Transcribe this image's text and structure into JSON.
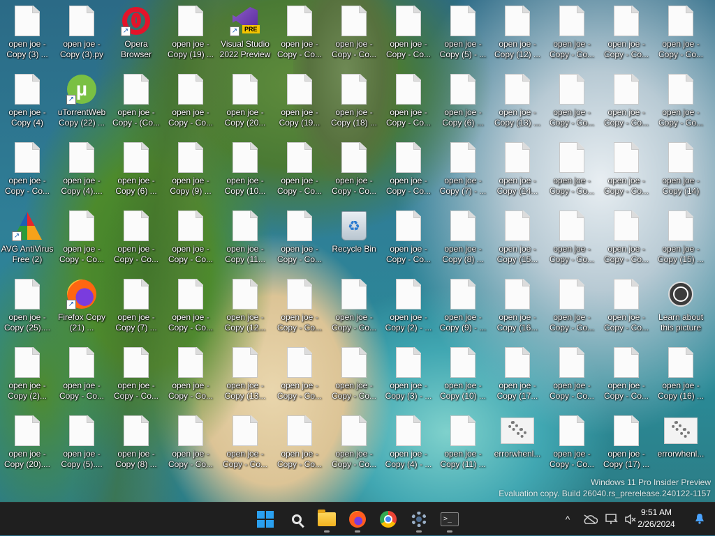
{
  "desktop": {
    "icons": [
      [
        "open joe - Copy (3) ...",
        "open joe - Copy (3).py",
        "Opera Browser",
        "open joe - Copy (19) ...",
        "Visual Studio 2022 Preview",
        "open joe - Copy - Co...",
        "open joe - Copy - Co...",
        "open joe - Copy - Co...",
        "open joe - Copy (5) - ...",
        "open joe - Copy (12) ...",
        "open joe - Copy - Co...",
        "open joe - Copy - Co...",
        "open joe - Copy - Co..."
      ],
      [
        "open joe - Copy (4)",
        "uTorrentWeb Copy (22) ...",
        "open joe - Copy - (Co...",
        "open joe - Copy - Co...",
        "open joe - Copy (20...",
        "open joe - Copy (19...",
        "open joe - Copy (18) ...",
        "open joe - Copy - Co...",
        "open joe - Copy (6) ...",
        "open joe - Copy (13) ...",
        "open joe - Copy - Co...",
        "open joe - Copy - Co...",
        "open joe - Copy - Co..."
      ],
      [
        "open joe - Copy - Co...",
        "open joe - Copy (4)....",
        "open joe - Copy (6) ...",
        "open joe - Copy (9) ...",
        "open joe - Copy (10...",
        "open joe - Copy - Co...",
        "open joe - Copy - Co...",
        "open joe - Copy - Co...",
        "open joe - Copy (7) - ...",
        "open joe - Copy (14...",
        "open joe - Copy - Co...",
        "open joe - Copy - Co...",
        "open joe - Copy (14)"
      ],
      [
        "AVG AntiVirus Free (2)",
        "open joe - Copy - Co...",
        "open joe - Copy - Co...",
        "open joe - Copy - Co...",
        "open joe - Copy (11...",
        "open joe - Copy - Co...",
        "Recycle Bin",
        "open joe - Copy - Co...",
        "open joe - Copy (8) ...",
        "open joe - Copy (15...",
        "open joe - Copy - Co...",
        "open joe - Copy - Co...",
        "open joe - Copy (15) ..."
      ],
      [
        "open joe - Copy (25)....",
        "Firefox Copy (21) ...",
        "open joe - Copy (7) ...",
        "open joe - Copy - Co...",
        "open joe - Copy (12...",
        "open joe - Copy - Co...",
        "open joe - Copy - Co...",
        "open joe - Copy (2) - ...",
        "open joe - Copy (9) - ...",
        "open joe - Copy (16...",
        "open joe - Copy - Co...",
        "open joe - Copy - Co...",
        "Learn about this picture"
      ],
      [
        "open joe - Copy (2)...",
        "open joe - Copy - Co...",
        "open joe - Copy - Co...",
        "open joe - Copy - Co...",
        "open joe - Copy (13...",
        "open joe - Copy - Co...",
        "open joe - Copy - Co...",
        "open joe - Copy (3) - ...",
        "open joe - Copy (10) ...",
        "open joe - Copy (17...",
        "open joe - Copy - Co...",
        "open joe - Copy - Co...",
        "open joe - Copy (16) ..."
      ],
      [
        "open joe - Copy (20)....",
        "open joe - Copy (5)....",
        "open joe - Copy (8) ...",
        "open joe - Copy - Co...",
        "open joe - Copy - Co...",
        "open joe - Copy - Co...",
        "open joe - Copy - Co...",
        "open joe - Copy (4) - ...",
        "open joe - Copy (11) ...",
        "errorwhenl...",
        "open joe - Copy - Co...",
        "open joe - Copy (17) ...",
        "errorwhenl..."
      ]
    ],
    "icon_types": {
      "0_2": "opera",
      "0_4": "vs",
      "1_1": "utorrent",
      "3_0": "avg",
      "3_6": "recycle",
      "4_1": "firefox",
      "4_12": "learn",
      "6_9": "errw",
      "6_12": "errw"
    },
    "shortcut_arrows": [
      "0_2",
      "0_4",
      "1_1",
      "3_0",
      "4_1"
    ],
    "vs_badge": "PRE",
    "utorrent_glyph": "µ",
    "watermark": {
      "line1": "Windows 11 Pro Insider Preview",
      "line2": "Evaluation copy. Build 26040.rs_prerelease.240122-1157"
    }
  },
  "taskbar": {
    "pinned": [
      "start-icon",
      "search-icon",
      "file-explorer-icon",
      "firefox-icon",
      "chrome-icon",
      "settings-icon",
      "terminal-icon"
    ],
    "tray": {
      "chevron": "^",
      "clock_time": "9:51 AM",
      "clock_date": "2/26/2024"
    }
  }
}
